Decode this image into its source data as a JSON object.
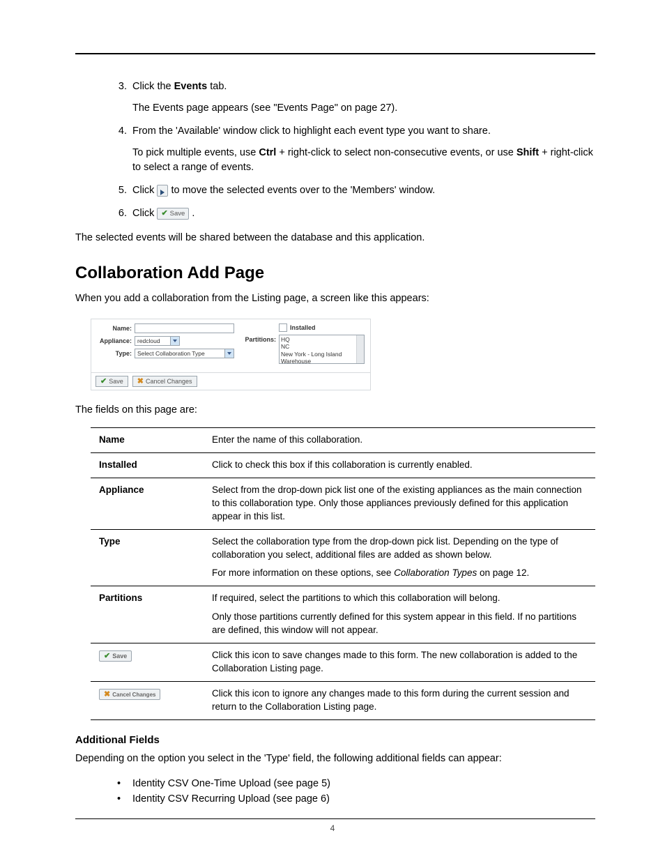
{
  "pageNumber": "4",
  "steps": {
    "s3a": "Click the ",
    "s3b": "Events",
    "s3c": " tab.",
    "s3sub": "The Events page appears (see \"Events Page\" on page 27).",
    "s4": "From the 'Available' window click to highlight each event type you want to share.",
    "s4sub_a": "To pick multiple events, use ",
    "s4sub_b": "Ctrl",
    "s4sub_c": " + right-click to select non-consecutive events, or use ",
    "s4sub_d": "Shift",
    "s4sub_e": " + right-click to select a range of events.",
    "s5a": "Click ",
    "s5b": " to move the selected events over to the 'Members' window.",
    "s6a": "Click ",
    "s6b": "."
  },
  "save_label": "Save",
  "outcome": "The selected events will be shared between the database and this application.",
  "section_heading": "Collaboration Add Page",
  "section_intro": "When you add a collaboration from the Listing page, a screen like this appears:",
  "form": {
    "name_label": "Name:",
    "appliance_label": "Appliance:",
    "appliance_value": "redcloud",
    "type_label": "Type:",
    "type_value": "Select Collaboration Type",
    "installed_label": "Installed",
    "partitions_label": "Partitions:",
    "partitions_items": [
      "HQ",
      "NC",
      "New York - Long Island Warehouse"
    ],
    "save_btn": "Save",
    "cancel_btn": "Cancel Changes"
  },
  "fields_intro": "The fields on this page are:",
  "table": {
    "name_h": "Name",
    "name_d": "Enter the name of this collaboration.",
    "installed_h": "Installed",
    "installed_d": "Click to check this box if this collaboration is currently enabled.",
    "appliance_h": "Appliance",
    "appliance_d": "Select from the drop-down pick list one of the existing appliances as the main connection to this collaboration type. Only those appliances previously defined for this application appear in this list.",
    "type_h": "Type",
    "type_d1": "Select the collaboration type from the drop-down pick list. Depending on the type of collaboration you select, additional files are added as shown below.",
    "type_d2a": "For more information on these options, see ",
    "type_d2b": "Collaboration Types",
    "type_d2c": " on page 12.",
    "partitions_h": "Partitions",
    "partitions_d1": "If required, select the partitions to which this collaboration will belong.",
    "partitions_d2": "Only those partitions currently defined for this system appear in this field. If no partitions are defined, this window will not appear.",
    "save_d": "Click this icon to save changes made to this form. The new collaboration is added to the Collaboration Listing page.",
    "cancel_d": "Click this icon to ignore any changes made to this form during the current session and return to the Collaboration Listing page."
  },
  "additional_heading": "Additional Fields",
  "additional_intro": "Depending on the option you select in the 'Type' field, the following additional fields can appear:",
  "additional_items": [
    "Identity CSV One-Time Upload (see page 5)",
    "Identity CSV Recurring Upload (see page 6)"
  ]
}
